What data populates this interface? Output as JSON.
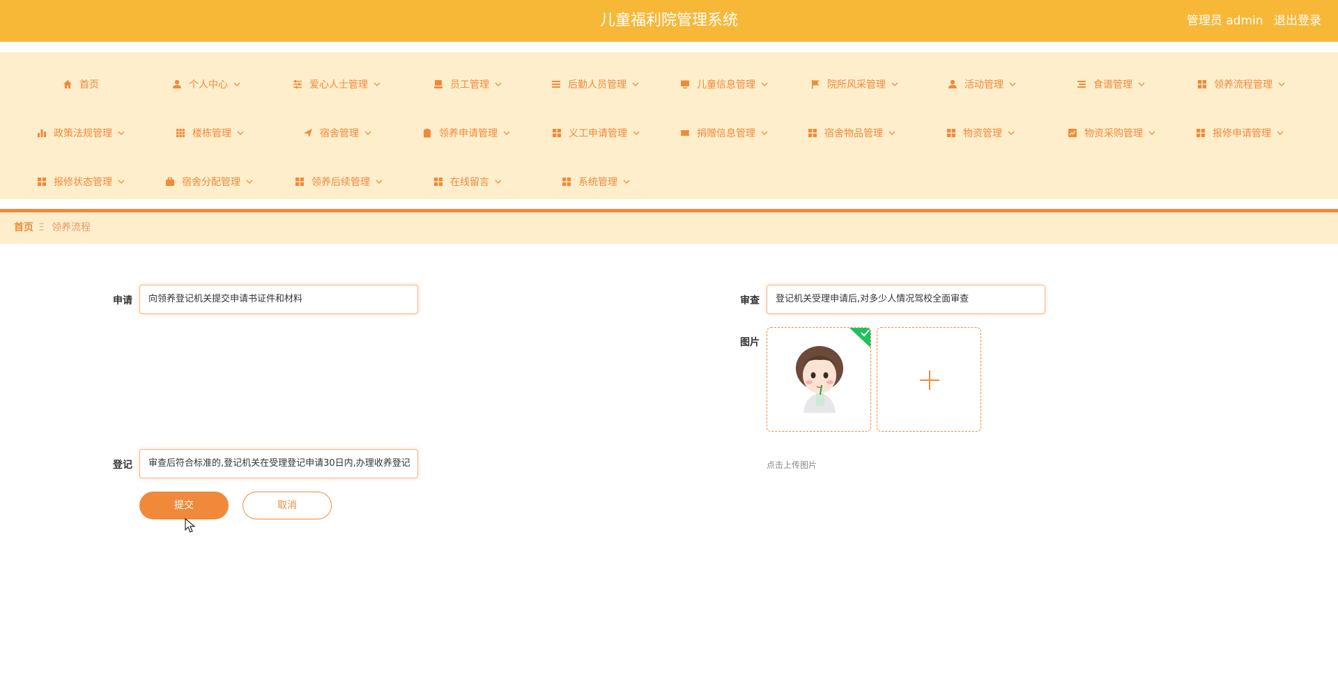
{
  "header": {
    "title": "儿童福利院管理系统",
    "user_label": "管理员 admin",
    "logout_label": "退出登录"
  },
  "nav": {
    "items": [
      {
        "label": "首页",
        "icon": "home-icon"
      },
      {
        "label": "个人中心",
        "icon": "user-icon"
      },
      {
        "label": "爱心人士管理",
        "icon": "sliders-icon"
      },
      {
        "label": "员工管理",
        "icon": "stack-icon"
      },
      {
        "label": "后勤人员管理",
        "icon": "list-icon"
      },
      {
        "label": "儿童信息管理",
        "icon": "monitor-icon"
      },
      {
        "label": "院所风采管理",
        "icon": "flag-icon"
      },
      {
        "label": "活动管理",
        "icon": "user-icon"
      },
      {
        "label": "食谱管理",
        "icon": "lines-icon"
      },
      {
        "label": "领养流程管理",
        "icon": "grid-icon"
      },
      {
        "label": "政策法规管理",
        "icon": "bar-chart-icon"
      },
      {
        "label": "楼栋管理",
        "icon": "grid9-icon"
      },
      {
        "label": "宿舍管理",
        "icon": "send-icon"
      },
      {
        "label": "领养申请管理",
        "icon": "clipboard-icon"
      },
      {
        "label": "义工申请管理",
        "icon": "grid-icon"
      },
      {
        "label": "捐赠信息管理",
        "icon": "ticket-icon"
      },
      {
        "label": "宿舍物品管理",
        "icon": "grid-icon"
      },
      {
        "label": "物资管理",
        "icon": "grid-icon"
      },
      {
        "label": "物资采购管理",
        "icon": "line-chart-icon"
      },
      {
        "label": "报修申请管理",
        "icon": "grid-icon"
      },
      {
        "label": "报修状态管理",
        "icon": "grid-icon"
      },
      {
        "label": "宿舍分配管理",
        "icon": "briefcase-icon"
      },
      {
        "label": "领养后续管理",
        "icon": "grid-icon"
      },
      {
        "label": "在线留言",
        "icon": "grid-icon"
      },
      {
        "label": "系统管理",
        "icon": "grid-icon"
      }
    ]
  },
  "breadcrumb": {
    "home": "首页",
    "separator": "Ξ",
    "current": "领养流程"
  },
  "form": {
    "apply": {
      "label": "申请",
      "value": "向领养登记机关提交申请书证件和材料"
    },
    "review": {
      "label": "审查",
      "value": "登记机关受理申请后,对多少人情况驾校全面审查"
    },
    "image": {
      "label": "图片",
      "upload_hint": "点击上传图片"
    },
    "register": {
      "label": "登记",
      "value": "审查后符合标准的,登记机关在受理登记申请30日内,办理收养登记"
    },
    "submit_label": "提交",
    "cancel_label": "取消"
  },
  "colors": {
    "header_bg": "#f7b838",
    "nav_bg": "#feeecc",
    "accent": "#f08a3a",
    "upload_success": "#1fc05f"
  }
}
